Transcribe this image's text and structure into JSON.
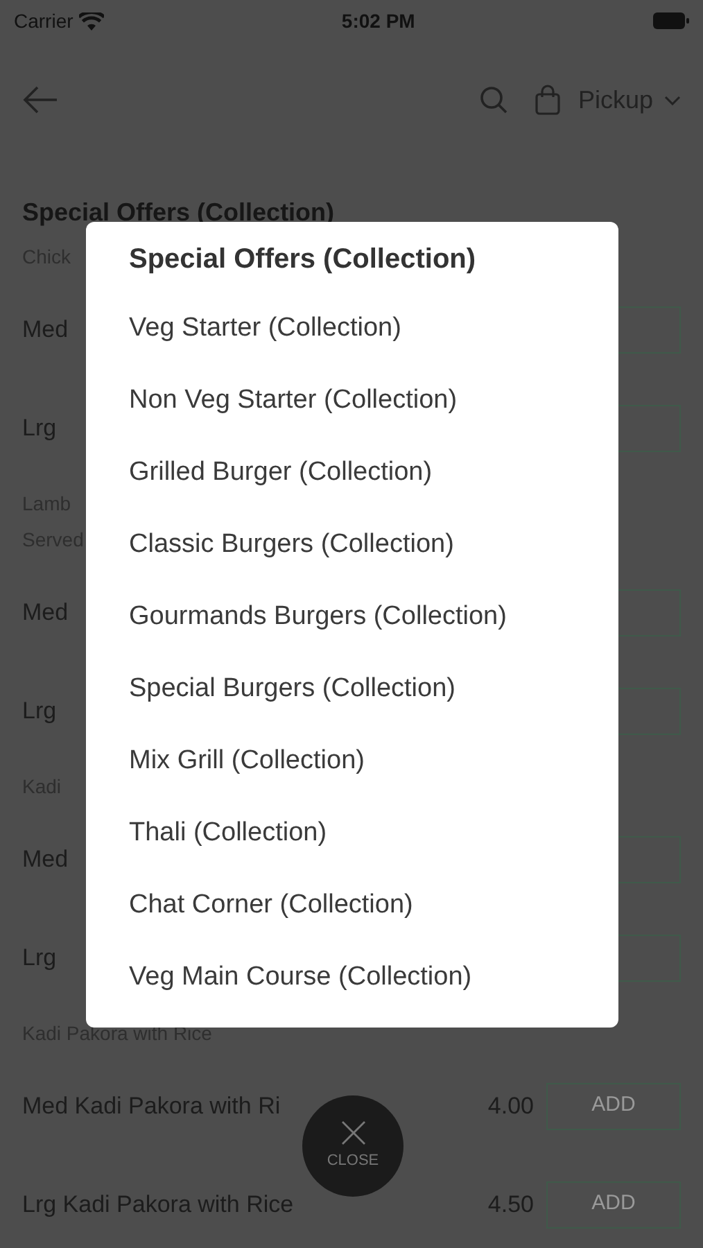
{
  "status_bar": {
    "carrier": "Carrier",
    "time": "5:02 PM"
  },
  "header": {
    "pickup_label": "Pickup"
  },
  "section_title": "Special Offers (Collection)",
  "rows": [
    {
      "kind": "subheading",
      "lines": [
        "Chick"
      ]
    },
    {
      "kind": "item",
      "name": "Med"
    },
    {
      "kind": "item",
      "name": "Lrg"
    },
    {
      "kind": "subheading",
      "lines": [
        "Lamb",
        "Served"
      ]
    },
    {
      "kind": "item",
      "name": "Med"
    },
    {
      "kind": "item",
      "name": "Lrg"
    },
    {
      "kind": "subheading",
      "lines": [
        "Kadi"
      ]
    },
    {
      "kind": "item",
      "name": "Med"
    },
    {
      "kind": "item",
      "name": "Lrg"
    },
    {
      "kind": "subheading",
      "lines": [
        "Kadi Pakora with Rice"
      ]
    },
    {
      "kind": "item",
      "name": "Med Kadi Pakora with Ri",
      "price": "4.00",
      "button": "ADD"
    },
    {
      "kind": "item",
      "name": "Lrg Kadi Pakora with Rice",
      "price": "4.50",
      "button": "ADD"
    }
  ],
  "menu": {
    "title": "Special Offers (Collection)",
    "items": [
      "Veg Starter (Collection)",
      "Non Veg Starter (Collection)",
      "Grilled Burger (Collection)",
      "Classic Burgers (Collection)",
      "Gourmands Burgers (Collection)",
      "Special Burgers (Collection)",
      "Mix Grill (Collection)",
      "Thali (Collection)",
      "Chat Corner (Collection)",
      "Veg Main Course (Collection)"
    ]
  },
  "close_button": {
    "label": "CLOSE"
  }
}
